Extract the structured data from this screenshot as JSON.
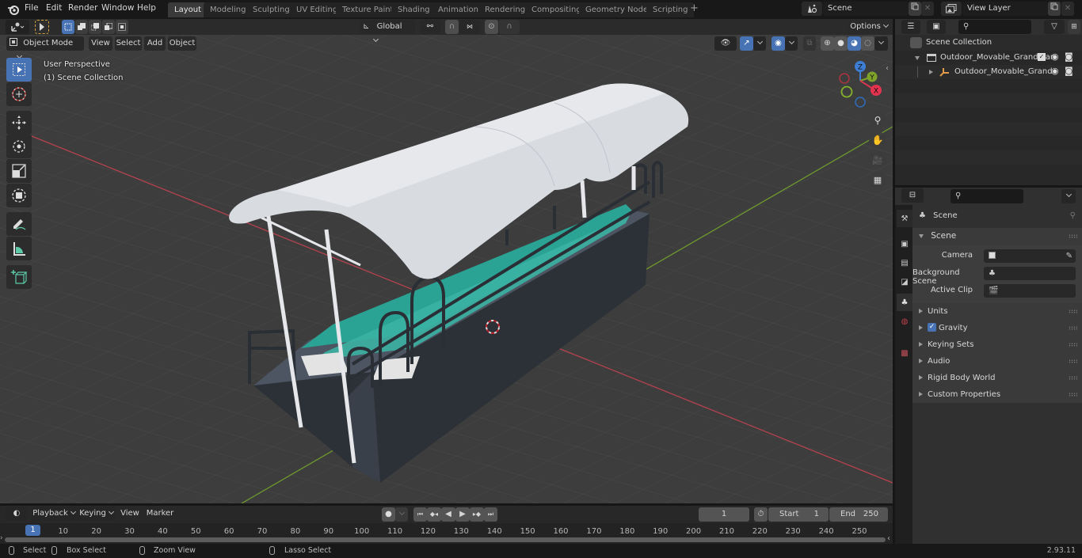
{
  "app": {
    "version": "2.93.11"
  },
  "topbar": {
    "menus": [
      "File",
      "Edit",
      "Render",
      "Window",
      "Help"
    ],
    "workspace_tabs": [
      {
        "label": "Layout",
        "active": true
      },
      {
        "label": "Modeling",
        "active": false
      },
      {
        "label": "Sculpting",
        "active": false
      },
      {
        "label": "UV Editing",
        "active": false
      },
      {
        "label": "Texture Paint",
        "active": false
      },
      {
        "label": "Shading",
        "active": false
      },
      {
        "label": "Animation",
        "active": false
      },
      {
        "label": "Rendering",
        "active": false
      },
      {
        "label": "Compositing",
        "active": false
      },
      {
        "label": "Geometry Nodes",
        "active": false
      },
      {
        "label": "Scripting",
        "active": false
      }
    ],
    "add_workspace": "+",
    "scene_name": "Scene",
    "view_layer_name": "View Layer"
  },
  "viewport": {
    "mode": "Object Mode",
    "menus": [
      "View",
      "Select",
      "Add",
      "Object"
    ],
    "transform_orientation": "Global",
    "options_label": "Options",
    "overlay_line1": "User Perspective",
    "overlay_line2": "(1) Scene Collection",
    "tools": [
      "select-box",
      "cursor",
      "move",
      "rotate",
      "scale",
      "transform",
      "annotate",
      "measure",
      "add-cube"
    ],
    "gizmo": {
      "x": "X",
      "y": "Y",
      "z": "Z"
    },
    "colors": {
      "background": "#3d3d3d",
      "grid": "#4a4a4a",
      "x_axis": "#b7424f",
      "y_axis": "#6e9a2c",
      "canopy": "#d8dbe0",
      "bench": "#2aa394",
      "base": "#2c3138",
      "rail": "#2a2f36",
      "active": "#4772b3"
    }
  },
  "outliner": {
    "root": "Scene Collection",
    "items": [
      {
        "label": "Outdoor_Movable_Grandstan",
        "type": "collection",
        "checked": true
      },
      {
        "label": "Outdoor_Movable_Grand",
        "type": "empty"
      }
    ]
  },
  "properties": {
    "header": "Scene",
    "section": "Scene",
    "fields": [
      {
        "label": "Camera",
        "value": ""
      },
      {
        "label": "Background Scene",
        "value": ""
      },
      {
        "label": "Active Clip",
        "value": ""
      }
    ],
    "panels": [
      {
        "label": "Units"
      },
      {
        "label": "Gravity",
        "checkbox": true
      },
      {
        "label": "Keying Sets"
      },
      {
        "label": "Audio"
      },
      {
        "label": "Rigid Body World"
      },
      {
        "label": "Custom Properties"
      }
    ]
  },
  "timeline": {
    "menus": [
      "Playback",
      "Keying",
      "View",
      "Marker"
    ],
    "current_frame": "1",
    "start_label": "Start",
    "start": "1",
    "end_label": "End",
    "end": "250",
    "ticks": [
      "10",
      "20",
      "30",
      "40",
      "50",
      "60",
      "70",
      "80",
      "90",
      "100",
      "110",
      "120",
      "130",
      "140",
      "150",
      "160",
      "170",
      "180",
      "190",
      "200",
      "210",
      "220",
      "230",
      "240",
      "250"
    ],
    "playhead": "1"
  },
  "statusbar": {
    "items": [
      "Select",
      "Box Select",
      "Zoom View",
      "Lasso Select"
    ]
  }
}
